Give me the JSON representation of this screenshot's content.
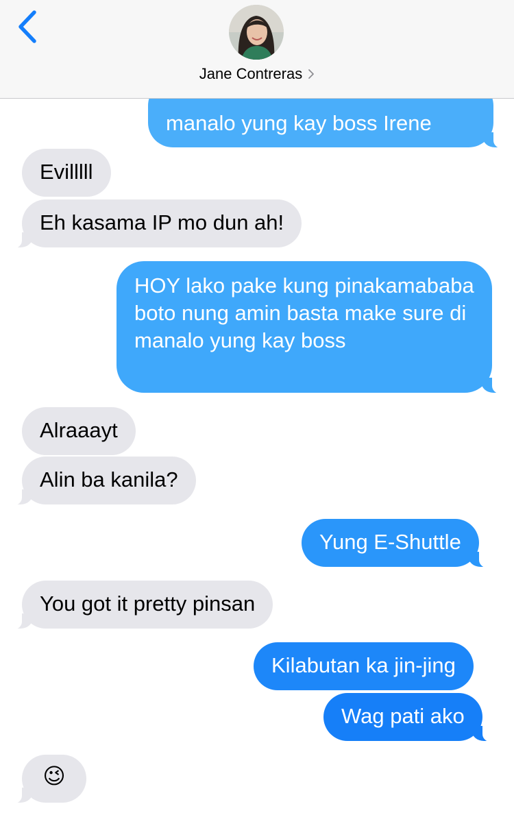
{
  "header": {
    "contact_name": "Jane Contreras"
  },
  "colors": {
    "incoming": "#e6e6eb",
    "outgoing_top": "#3aa9fb",
    "outgoing_bottom": "#137ff8",
    "accent": "#147efb"
  },
  "messages": [
    {
      "dir": "out",
      "text": "manalo yung kay boss Irene"
    },
    {
      "dir": "in",
      "text": "Evilllll"
    },
    {
      "dir": "in",
      "text": "Eh kasama IP mo dun ah!"
    },
    {
      "dir": "out",
      "text": "HOY lako pake kung pinakamababa boto nung amin basta make sure di manalo yung kay boss"
    },
    {
      "dir": "in",
      "text": "Alraaayt"
    },
    {
      "dir": "in",
      "text": "Alin ba kanila?"
    },
    {
      "dir": "out",
      "text": "Yung E-Shuttle"
    },
    {
      "dir": "in",
      "text": "You got it pretty pinsan"
    },
    {
      "dir": "out",
      "text": "Kilabutan ka jin-jing"
    },
    {
      "dir": "out",
      "text": "Wag pati ako"
    },
    {
      "dir": "in",
      "text": "😉"
    }
  ]
}
